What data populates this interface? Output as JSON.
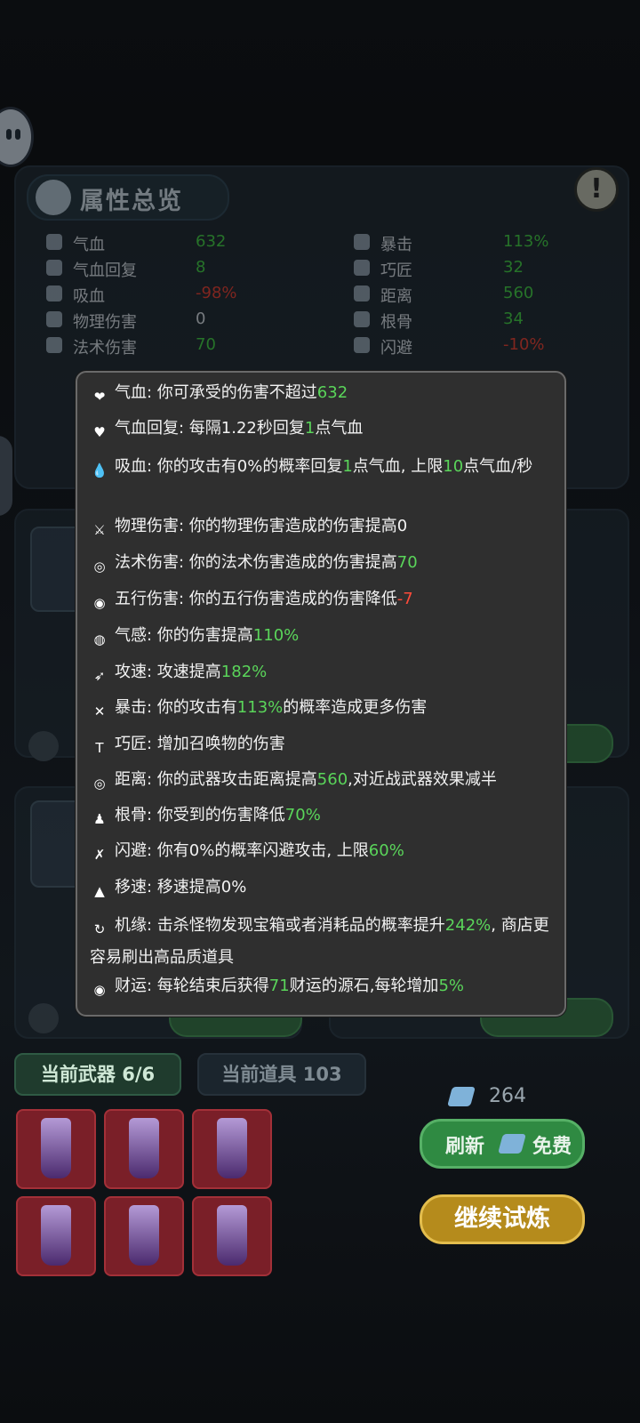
{
  "attributes_panel": {
    "title": "属性总览",
    "left_stats": [
      {
        "name": "气血",
        "value": "632",
        "value_color": "green"
      },
      {
        "name": "气血回复",
        "value": "8",
        "value_color": "green"
      },
      {
        "name": "吸血",
        "value": "-98%",
        "value_color": "red"
      },
      {
        "name": "物理伤害",
        "value": "0",
        "value_color": "gray"
      },
      {
        "name": "法术伤害",
        "value": "70",
        "value_color": "green"
      }
    ],
    "right_stats": [
      {
        "name": "暴击",
        "value": "113%",
        "value_color": "green"
      },
      {
        "name": "巧匠",
        "value": "32",
        "value_color": "green"
      },
      {
        "name": "距离",
        "value": "560",
        "value_color": "green"
      },
      {
        "name": "根骨",
        "value": "34",
        "value_color": "green"
      },
      {
        "name": "闪避",
        "value": "-10%",
        "value_color": "red"
      }
    ]
  },
  "bottom": {
    "tab_weapons": "当前武器 6/6",
    "tab_items": "当前道具 103",
    "crystal_count": "264",
    "refresh_label": "刷新",
    "free_label": "免费",
    "continue_label": "继续试炼"
  },
  "tooltip": {
    "rows": [
      {
        "icon": "heart-icon",
        "glyph": "❤",
        "parts": [
          {
            "t": "气血: 你可承受的伤害不超过"
          },
          {
            "t": "632",
            "c": "g"
          }
        ]
      },
      {
        "icon": "heart-regen-icon",
        "glyph": "♥",
        "parts": [
          {
            "t": "气血回复: 每隔1.22秒回复"
          },
          {
            "t": "1",
            "c": "g"
          },
          {
            "t": "点气血"
          }
        ]
      },
      {
        "icon": "blood-drop-icon",
        "glyph": "💧",
        "parts": [
          {
            "t": "吸血: 你的攻击有0%的概率回复"
          },
          {
            "t": "1",
            "c": "g"
          },
          {
            "t": "点气血, 上限"
          },
          {
            "t": "10",
            "c": "g"
          },
          {
            "t": "点气血/秒"
          }
        ],
        "wrap": true
      },
      {
        "icon": "sword-icon",
        "glyph": "⚔",
        "parts": [
          {
            "t": "物理伤害: 你的物理伤害造成的伤害提高0"
          }
        ]
      },
      {
        "icon": "spiral-icon",
        "glyph": "◎",
        "parts": [
          {
            "t": "法术伤害: 你的法术伤害造成的伤害提高"
          },
          {
            "t": "70",
            "c": "g"
          }
        ]
      },
      {
        "icon": "five-elements-icon",
        "glyph": "◉",
        "parts": [
          {
            "t": "五行伤害: 你的五行伤害造成的伤害降低"
          },
          {
            "t": "-7",
            "c": "r"
          }
        ]
      },
      {
        "icon": "qi-icon",
        "glyph": "◍",
        "parts": [
          {
            "t": "气感: 你的伤害提高"
          },
          {
            "t": "110%",
            "c": "g"
          }
        ]
      },
      {
        "icon": "attack-speed-icon",
        "glyph": "➶",
        "parts": [
          {
            "t": "攻速: 攻速提高"
          },
          {
            "t": "182%",
            "c": "g"
          }
        ]
      },
      {
        "icon": "crit-icon",
        "glyph": "✕",
        "parts": [
          {
            "t": "暴击: 你的攻击有"
          },
          {
            "t": "113%",
            "c": "g"
          },
          {
            "t": "的概率造成更多伤害"
          }
        ]
      },
      {
        "icon": "hammer-icon",
        "glyph": "T",
        "parts": [
          {
            "t": "巧匠: 增加召唤物的伤害"
          }
        ]
      },
      {
        "icon": "target-icon",
        "glyph": "◎",
        "parts": [
          {
            "t": "距离: 你的武器攻击距离提高"
          },
          {
            "t": "560",
            "c": "g"
          },
          {
            "t": ",对近战武器效果减半"
          }
        ]
      },
      {
        "icon": "meditation-icon",
        "glyph": "♟",
        "parts": [
          {
            "t": "根骨: 你受到的伤害降低"
          },
          {
            "t": "70%",
            "c": "g"
          }
        ]
      },
      {
        "icon": "dodge-icon",
        "glyph": "✗",
        "parts": [
          {
            "t": "闪避: 你有0%的概率闪避攻击, 上限"
          },
          {
            "t": "60%",
            "c": "g"
          }
        ]
      },
      {
        "icon": "boot-icon",
        "glyph": "▲",
        "parts": [
          {
            "t": "移速: 移速提高0%"
          }
        ]
      },
      {
        "icon": "luck-icon",
        "glyph": "↻",
        "parts": [
          {
            "t": "机缘: 击杀怪物发现宝箱或者消耗品的概率提升"
          },
          {
            "t": "242%",
            "c": "g"
          },
          {
            "t": ", 商店更容易刷出高品质道具"
          }
        ],
        "wrap": true
      },
      {
        "icon": "coin-icon",
        "glyph": "◉",
        "parts": [
          {
            "t": "财运: 每轮结束后获得"
          },
          {
            "t": "71",
            "c": "g"
          },
          {
            "t": "财运的源石,每轮增加"
          },
          {
            "t": "5%",
            "c": "g"
          }
        ]
      }
    ]
  }
}
